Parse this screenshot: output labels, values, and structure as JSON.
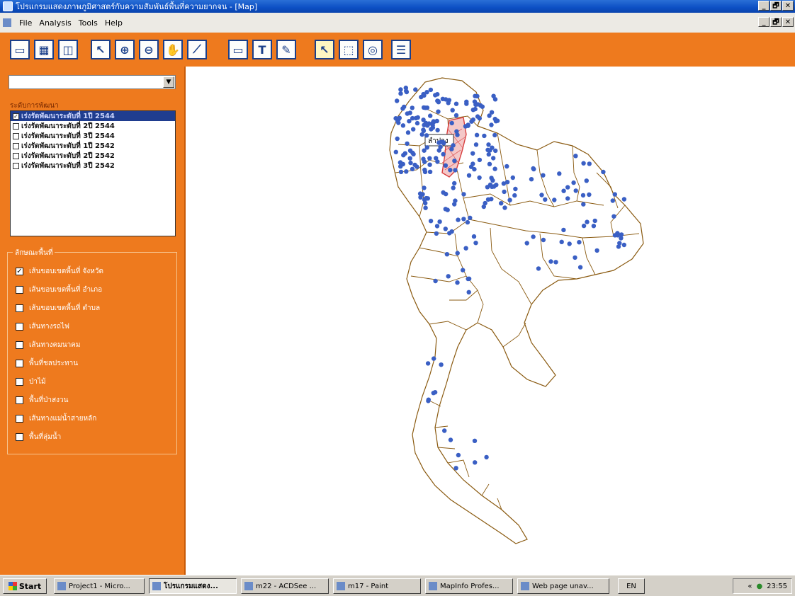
{
  "window": {
    "title": "โปรแกรมแสดงภาพภูมิศาสตร์กับความสัมพันธ์พื้นที่ความยากจน - [Map]",
    "buttons": [
      "_",
      "🗗",
      "✕"
    ]
  },
  "menu": [
    "File",
    "Analysis",
    "Tools",
    "Help"
  ],
  "toolbar": {
    "icons": [
      "open-icon",
      "table-icon",
      "layers-open-icon",
      "select-arrow-icon",
      "zoom-in-icon",
      "zoom-out-icon",
      "pan-hand-icon",
      "ruler-icon",
      "label-icon",
      "text-icon",
      "pin-icon",
      "info-select-icon",
      "rect-select-icon",
      "radius-select-icon",
      "layer-control-icon"
    ],
    "active_tool": "info-select-icon"
  },
  "sidebar": {
    "combo_value": "",
    "dev_level_label": "ระดับการพัฒนา",
    "dev_levels": [
      {
        "label": "เร่งรัดพัฒนาระดับที่ 1ปี 2544",
        "checked": true,
        "selected": true
      },
      {
        "label": "เร่งรัดพัฒนาระดับที่ 2ปี 2544",
        "checked": false,
        "selected": false
      },
      {
        "label": "เร่งรัดพัฒนาระดับที่ 3ปี 2544",
        "checked": false,
        "selected": false
      },
      {
        "label": "เร่งรัดพัฒนาระดับที่ 1ปี 2542",
        "checked": false,
        "selected": false
      },
      {
        "label": "เร่งรัดพัฒนาระดับที่ 2ปี 2542",
        "checked": false,
        "selected": false
      },
      {
        "label": "เร่งรัดพัฒนาระดับที่ 3ปี 2542",
        "checked": false,
        "selected": false
      }
    ],
    "area_label": "ลักษณะพื้นที่",
    "layers": [
      {
        "label": "เส้นขอบเขตพื้นที่ จังหวัด",
        "checked": true
      },
      {
        "label": "เส้นขอบเขตพื้นที่ อำเภอ",
        "checked": false
      },
      {
        "label": "เส้นขอบเขตพื้นที่ ตำบล",
        "checked": false
      },
      {
        "label": "เส้นทางรถไฟ",
        "checked": false
      },
      {
        "label": "เส้นทางคมนาคม",
        "checked": false
      },
      {
        "label": "พื้นที่ชลประทาน",
        "checked": false
      },
      {
        "label": "ป่าไม้",
        "checked": false
      },
      {
        "label": "พื้นที่ป่าสงวน",
        "checked": false
      },
      {
        "label": "เส้นทางแม่น้ำสายหลัก",
        "checked": false
      },
      {
        "label": "พื้นที่ลุ่มน้ำ",
        "checked": false
      }
    ]
  },
  "map": {
    "selected_province_label": "ลำปาง",
    "boundary_color": "#8a5a10",
    "point_color": "#3a5fc4",
    "highlight_color": "#d84040"
  },
  "taskbar": {
    "start_label": "Start",
    "tasks": [
      {
        "label": "Project1 - Micro...",
        "active": false
      },
      {
        "label": "โปรแกรมแสดง...",
        "active": true
      },
      {
        "label": "m22 - ACDSee ...",
        "active": false
      },
      {
        "label": "m17 - Paint",
        "active": false
      },
      {
        "label": "MapInfo Profes...",
        "active": false
      },
      {
        "label": "Web page unav...",
        "active": false
      }
    ],
    "tray_lang": "EN",
    "clock": "23:55"
  }
}
